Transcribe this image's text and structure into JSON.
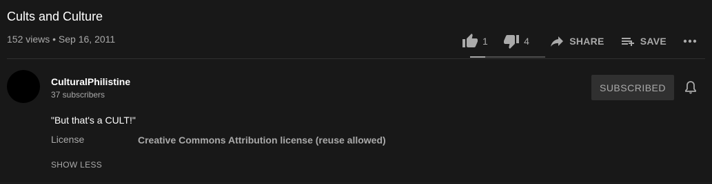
{
  "video": {
    "title": "Cults and Culture",
    "views": "152 views",
    "separator": "•",
    "date": "Sep 16, 2011",
    "meta": "152 views • Sep 16, 2011"
  },
  "actions": {
    "likes": "1",
    "dislikes": "4",
    "share_label": "SHARE",
    "save_label": "SAVE",
    "like_ratio": 0.2,
    "icons": {
      "like": "thumbs-up-icon",
      "dislike": "thumbs-down-icon",
      "share": "share-arrow-icon",
      "save": "playlist-add-icon",
      "more": "more-horizontal-icon"
    }
  },
  "channel": {
    "name": "CulturalPhilistine",
    "subscribers": "37 subscribers",
    "subscribe_label": "SUBSCRIBED",
    "bell_icon": "notification-bell-icon"
  },
  "description": {
    "text": "\"But that's a CULT!\"",
    "license_label": "License",
    "license_value": "Creative Commons Attribution license (reuse allowed)",
    "show_less": "SHOW LESS"
  },
  "colors": {
    "background": "#181818",
    "primary_text": "#ffffff",
    "secondary_text": "#aaaaaa",
    "button_bg": "#303030"
  }
}
